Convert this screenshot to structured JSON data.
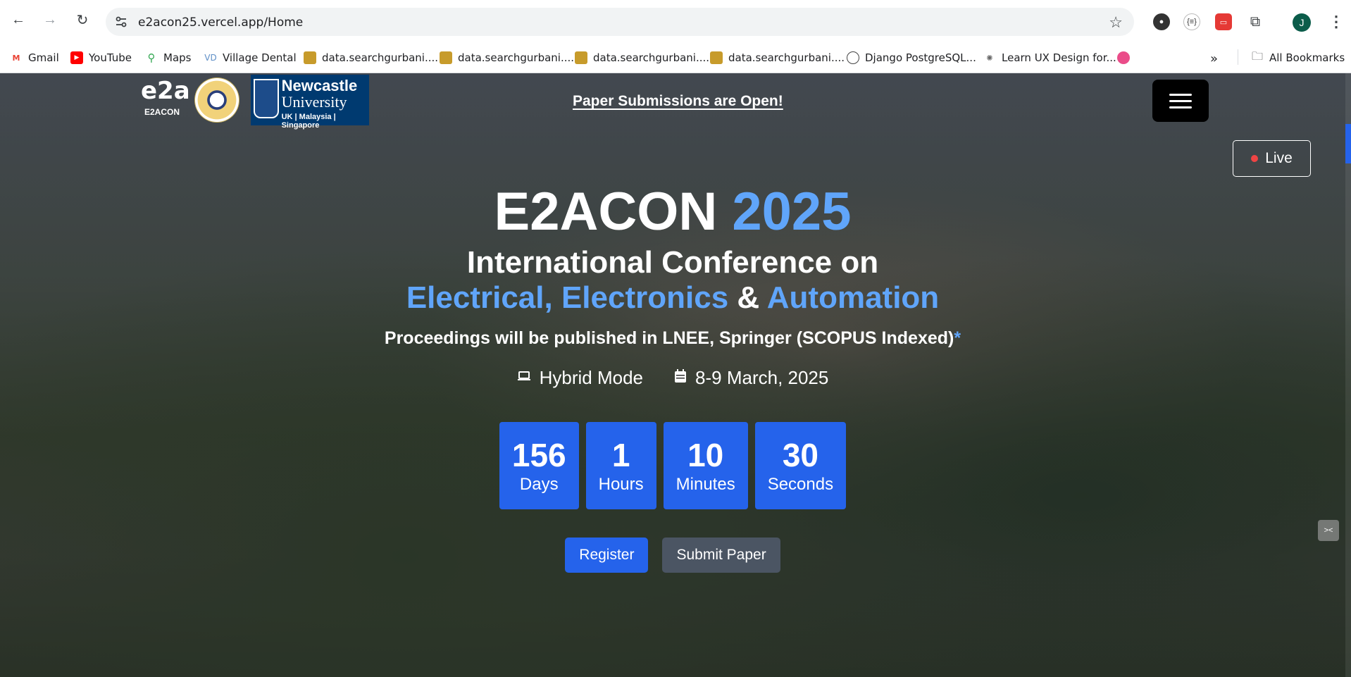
{
  "browser": {
    "url": "e2acon25.vercel.app/Home",
    "bookmarks": [
      {
        "label": "Gmail",
        "icon": "gmail-icon",
        "color": "#ea4335"
      },
      {
        "label": "YouTube",
        "icon": "youtube-icon",
        "color": "#ff0000"
      },
      {
        "label": "Maps",
        "icon": "maps-icon",
        "color": "#34a853"
      },
      {
        "label": "Village Dental",
        "icon": "vd-icon",
        "color": "#5f8fc7"
      },
      {
        "label": "data.searchgurbani....",
        "icon": "folder-image-icon",
        "color": "#c79b2b"
      },
      {
        "label": "data.searchgurbani....",
        "icon": "folder-image-icon",
        "color": "#c79b2b"
      },
      {
        "label": "data.searchgurbani....",
        "icon": "folder-image-icon",
        "color": "#c79b2b"
      },
      {
        "label": "data.searchgurbani....",
        "icon": "folder-image-icon",
        "color": "#c79b2b"
      },
      {
        "label": "Django PostgreSQL...",
        "icon": "django-icon",
        "color": "#444444"
      },
      {
        "label": "Learn UX Design for...",
        "icon": "ux-icon",
        "color": "#666666"
      }
    ],
    "all_bookmarks": "All Bookmarks",
    "avatar_initial": "J"
  },
  "site": {
    "logo_e2acon_mark": "e2a",
    "logo_e2acon_text": "E2ACON",
    "newcastle_name_1": "Newcastle",
    "newcastle_name_2": "University",
    "newcastle_locations": "UK | Malaysia | Singapore",
    "announcement": "Paper Submissions are Open!",
    "live_label": "Live",
    "title_main": "E2ACON",
    "title_year": "2025",
    "subtitle_line1": "International Conference on",
    "subtitle_electrical": "Electrical,",
    "subtitle_electronics": "Electronics",
    "subtitle_amp": "&",
    "subtitle_automation": "Automation",
    "proceedings": "Proceedings will be published in LNEE, Springer (SCOPUS Indexed)",
    "proceedings_star": "*",
    "mode": "Hybrid Mode",
    "dates": "8-9 March, 2025",
    "countdown": [
      {
        "value": "156",
        "label": "Days"
      },
      {
        "value": "1",
        "label": "Hours"
      },
      {
        "value": "10",
        "label": "Minutes"
      },
      {
        "value": "30",
        "label": "Seconds"
      }
    ],
    "register_label": "Register",
    "submit_label": "Submit Paper"
  },
  "colors": {
    "accent_blue": "#60a5fa",
    "primary_button": "#2563eb",
    "secondary_button": "#4b5563",
    "live_dot": "#ef4444"
  }
}
